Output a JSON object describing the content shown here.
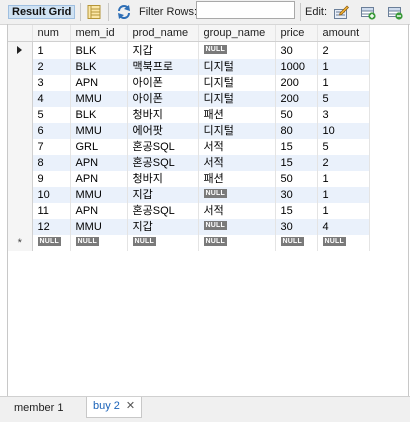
{
  "toolbar": {
    "result_grid": "Result Grid",
    "filter_rows_label": "Filter Rows:",
    "filter_value": "",
    "edit_label": "Edit:"
  },
  "grid": {
    "columns": [
      "num",
      "mem_id",
      "prod_name",
      "group_name",
      "price",
      "amount"
    ],
    "rows": [
      [
        "1",
        "BLK",
        "지갑",
        "NULL",
        "30",
        "2"
      ],
      [
        "2",
        "BLK",
        "맥북프로",
        "디지털",
        "1000",
        "1"
      ],
      [
        "3",
        "APN",
        "아이폰",
        "디지털",
        "200",
        "1"
      ],
      [
        "4",
        "MMU",
        "아이폰",
        "디지털",
        "200",
        "5"
      ],
      [
        "5",
        "BLK",
        "청바지",
        "패션",
        "50",
        "3"
      ],
      [
        "6",
        "MMU",
        "에어팟",
        "디지털",
        "80",
        "10"
      ],
      [
        "7",
        "GRL",
        "혼공SQL",
        "서적",
        "15",
        "5"
      ],
      [
        "8",
        "APN",
        "혼공SQL",
        "서적",
        "15",
        "2"
      ],
      [
        "9",
        "APN",
        "청바지",
        "패션",
        "50",
        "1"
      ],
      [
        "10",
        "MMU",
        "지갑",
        "NULL",
        "30",
        "1"
      ],
      [
        "11",
        "APN",
        "혼공SQL",
        "서적",
        "15",
        "1"
      ],
      [
        "12",
        "MMU",
        "지갑",
        "NULL",
        "30",
        "4"
      ]
    ],
    "new_row": [
      "NULL",
      "NULL",
      "NULL",
      "NULL",
      "NULL",
      "NULL"
    ],
    "new_row_marker": "*"
  },
  "tabs": [
    {
      "label": "member 1",
      "active": false
    },
    {
      "label": "buy 2",
      "active": true,
      "close": "✕"
    }
  ]
}
